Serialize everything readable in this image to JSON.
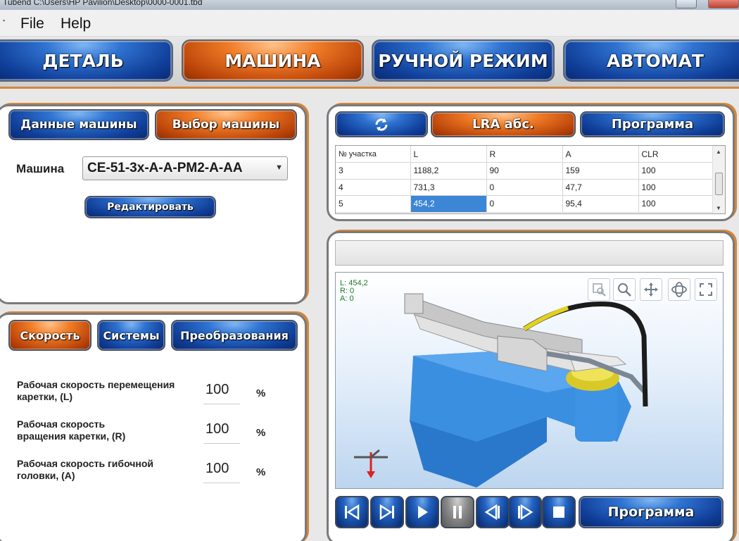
{
  "window": {
    "title": "Tubend C:\\Users\\HP Pavilion\\Desktop\\0000-0001.tbd"
  },
  "menu": {
    "items": [
      "File",
      "Help"
    ]
  },
  "nav": {
    "tabs": [
      {
        "label": "ДЕТАЛЬ",
        "active": false
      },
      {
        "label": "МАШИНА",
        "active": true
      },
      {
        "label": "РУЧНОЙ РЕЖИМ",
        "active": false
      },
      {
        "label": "АВТОМАТ",
        "active": false
      }
    ]
  },
  "machine_panel": {
    "tab_data": "Данные машины",
    "tab_select": "Выбор машины",
    "machine_label": "Машина",
    "machine_value": "CE-51-3x-A-A-PM2-A-AA",
    "edit_button": "Редактировать"
  },
  "speed_panel": {
    "tab_speed": "Скорость",
    "tab_systems": "Системы",
    "tab_transform": "Преобразования",
    "rows": [
      {
        "label_line1": "Рабочая скорость перемещения",
        "label_line2": "каретки, (L)",
        "value": "100",
        "unit": "%"
      },
      {
        "label_line1": "Рабочая скорость",
        "label_line2": "вращения каретки, (R)",
        "value": "100",
        "unit": "%"
      },
      {
        "label_line1": "Рабочая скорость гибочной",
        "label_line2": "головки, (A)",
        "value": "100",
        "unit": "%"
      }
    ]
  },
  "program_panel": {
    "refresh_icon": "refresh-icon",
    "lra_button": "LRA абс.",
    "program_button": "Программа",
    "columns": [
      "№ участка",
      "L",
      "R",
      "A",
      "CLR"
    ],
    "rows": [
      [
        "3",
        "1188,2",
        "90",
        "159",
        "100"
      ],
      [
        "4",
        "731,3",
        "0",
        "47,7",
        "100"
      ],
      [
        "5",
        "454,2",
        "0",
        "95,4",
        "100"
      ]
    ],
    "selected_cell": "454,2"
  },
  "viewport": {
    "readout": [
      "L: 454,2",
      "R: 0",
      "A: 0"
    ],
    "tools": [
      "zoom-window-icon",
      "zoom-icon",
      "pan-icon",
      "rotate-icon",
      "fit-icon"
    ]
  },
  "controls": {
    "buttons": [
      "skip-start-icon",
      "skip-end-icon",
      "play-icon",
      "pause-icon",
      "step-back-icon",
      "step-forward-icon",
      "stop-icon"
    ],
    "program_label": "Программа"
  },
  "colors": {
    "blue": "#0f3d97",
    "orange": "#f07b26",
    "accent_border": "#d5863b",
    "selection": "#3d86d6"
  }
}
